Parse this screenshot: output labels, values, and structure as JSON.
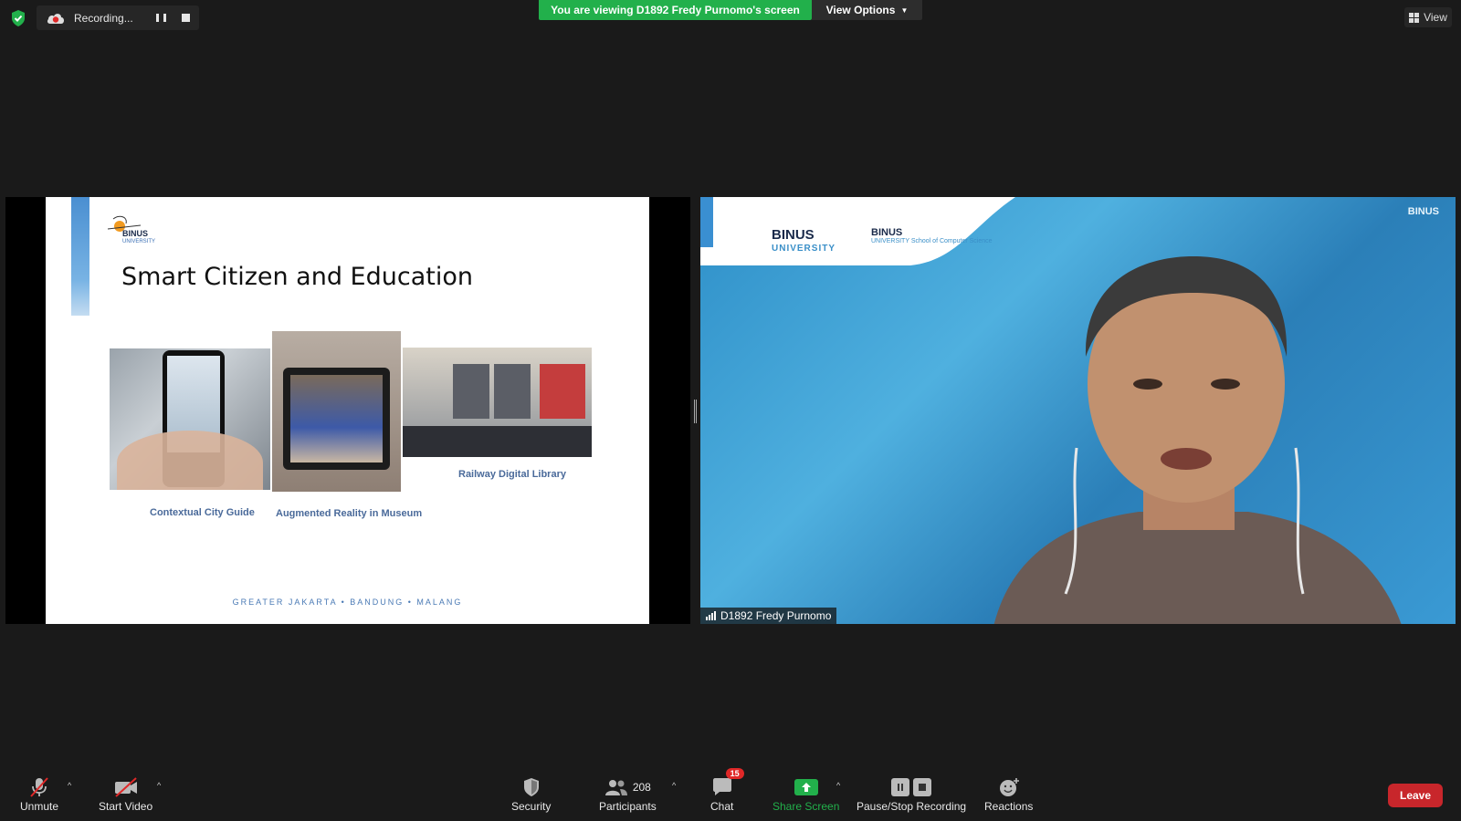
{
  "top": {
    "recording_label": "Recording...",
    "viewing_banner": "You are viewing D1892 Fredy Purnomo's screen",
    "view_options_label": "View Options",
    "view_label": "View"
  },
  "slide": {
    "logo_name": "BINUS",
    "logo_sub": "UNIVERSITY",
    "title": "Smart Citizen and Education",
    "captions": [
      "Contextual City Guide",
      "Augmented Reality in Museum",
      "Railway Digital Library"
    ],
    "footer": "GREATER JAKARTA • BANDUNG • MALANG"
  },
  "video": {
    "participant_name": "D1892 Fredy Purnomo",
    "logo1_name": "BINUS",
    "logo1_sub": "UNIVERSITY",
    "logo2_name": "BINUS",
    "logo2_sub": "UNIVERSITY School of Computer Science",
    "corner_logo": "BINUS"
  },
  "toolbar": {
    "unmute": "Unmute",
    "start_video": "Start Video",
    "security": "Security",
    "participants": "Participants",
    "participants_count": "208",
    "chat": "Chat",
    "chat_badge": "15",
    "share_screen": "Share Screen",
    "pause_stop": "Pause/Stop Recording",
    "reactions": "Reactions",
    "leave": "Leave"
  },
  "colors": {
    "banner_green": "#22b04b",
    "leave_red": "#c8262b",
    "slide_caption": "#4a6a9a"
  }
}
